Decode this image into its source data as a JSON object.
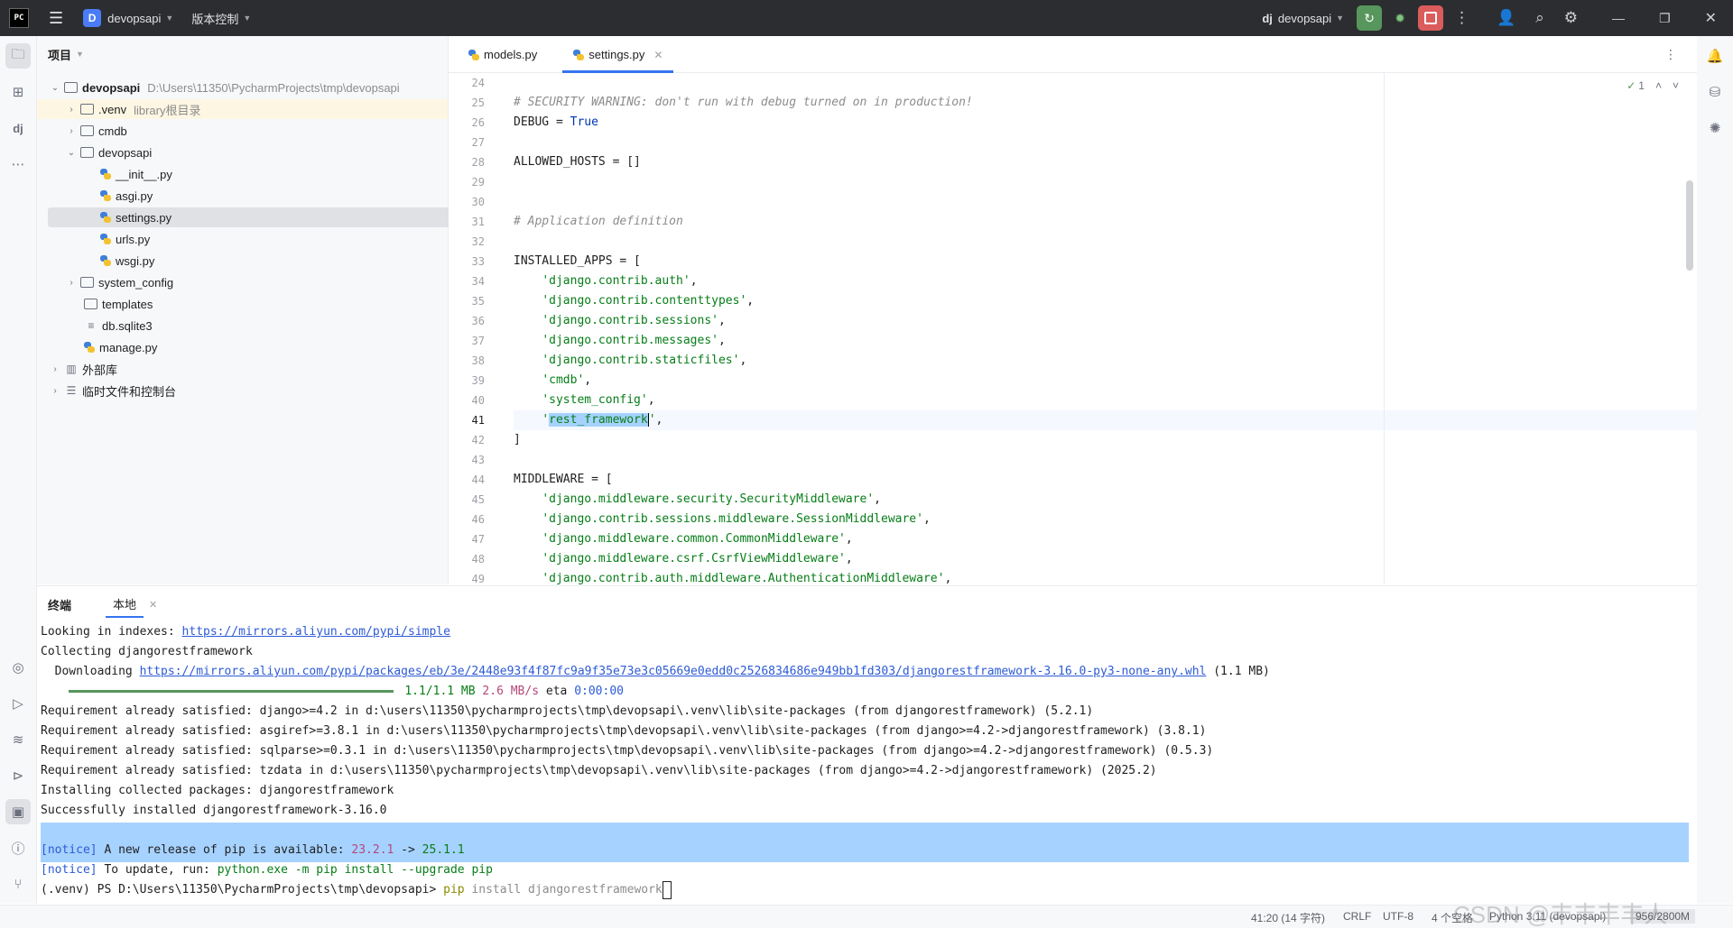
{
  "titlebar": {
    "app_logo": "PC",
    "project_badge": "D",
    "project_name": "devopsapi",
    "vcs_label": "版本控制",
    "run_config": "devopsapi",
    "run_config_icon": "dj"
  },
  "project_panel": {
    "title": "项目",
    "tree": [
      {
        "label": "devopsapi",
        "path": "D:\\Users\\11350\\PycharmProjects\\tmp\\devopsapi"
      },
      {
        "label": ".venv",
        "hint": "library根目录"
      },
      {
        "label": "cmdb"
      },
      {
        "label": "devopsapi"
      },
      {
        "label": "__init__.py"
      },
      {
        "label": "asgi.py"
      },
      {
        "label": "settings.py"
      },
      {
        "label": "urls.py"
      },
      {
        "label": "wsgi.py"
      },
      {
        "label": "system_config"
      },
      {
        "label": "templates"
      },
      {
        "label": "db.sqlite3"
      },
      {
        "label": "manage.py"
      },
      {
        "label": "外部库"
      },
      {
        "label": "临时文件和控制台"
      }
    ]
  },
  "editor": {
    "tabs": [
      {
        "label": "models.py"
      },
      {
        "label": "settings.py"
      }
    ],
    "inspection_count": "1",
    "line_numbers": [
      "24",
      "25",
      "26",
      "27",
      "28",
      "29",
      "30",
      "31",
      "32",
      "33",
      "34",
      "35",
      "36",
      "37",
      "38",
      "39",
      "40",
      "41",
      "42",
      "43",
      "44",
      "45",
      "46",
      "47",
      "48",
      "49"
    ],
    "code": {
      "l25": "# SECURITY WARNING: don't run with debug turned on in production!",
      "l26_a": "DEBUG = ",
      "l26_b": "True",
      "l28": "ALLOWED_HOSTS = []",
      "l31": "# Application definition",
      "l33": "INSTALLED_APPS = [",
      "l34": "'django.contrib.auth'",
      "l35": "'django.contrib.contenttypes'",
      "l36": "'django.contrib.sessions'",
      "l37": "'django.contrib.messages'",
      "l38": "'django.contrib.staticfiles'",
      "l39": "'cmdb'",
      "l40": "'system_config'",
      "l41_sel": "rest_framework",
      "l42": "]",
      "l44": "MIDDLEWARE = [",
      "l45": "'django.middleware.security.SecurityMiddleware'",
      "l46": "'django.contrib.sessions.middleware.SessionMiddleware'",
      "l47": "'django.middleware.common.CommonMiddleware'",
      "l48": "'django.middleware.csrf.CsrfViewMiddleware'",
      "l49": "'django.contrib.auth.middleware.AuthenticationMiddleware'"
    }
  },
  "terminal": {
    "tabs": [
      {
        "label": "终端"
      },
      {
        "label": "本地"
      }
    ],
    "lines": {
      "t1_a": "Looking in indexes: ",
      "t1_link": "https://mirrors.aliyun.com/pypi/simple",
      "t2": "Collecting djangorestframework",
      "t3_a": "  Downloading ",
      "t3_link": "https://mirrors.aliyun.com/pypi/packages/eb/3e/2448e93f4f87fc9a9f35e73e3c05669e0edd0c2526834686e949bb1fd303/djangorestframework-3.16.0-py3-none-any.whl",
      "t3_b": " (1.1 MB)",
      "t4_progress": "1.1/1.1 MB",
      "t4_speed": "2.6 MB/s",
      "t4_eta_label": "eta",
      "t4_eta": "0:00:00",
      "t5": "Requirement already satisfied: django>=4.2 in d:\\users\\11350\\pycharmprojects\\tmp\\devopsapi\\.venv\\lib\\site-packages (from djangorestframework) (5.2.1)",
      "t6": "Requirement already satisfied: asgiref>=3.8.1 in d:\\users\\11350\\pycharmprojects\\tmp\\devopsapi\\.venv\\lib\\site-packages (from django>=4.2->djangorestframework) (3.8.1)",
      "t7": "Requirement already satisfied: sqlparse>=0.3.1 in d:\\users\\11350\\pycharmprojects\\tmp\\devopsapi\\.venv\\lib\\site-packages (from django>=4.2->djangorestframework) (0.5.3)",
      "t8": "Requirement already satisfied: tzdata in d:\\users\\11350\\pycharmprojects\\tmp\\devopsapi\\.venv\\lib\\site-packages (from django>=4.2->djangorestframework) (2025.2)",
      "t9": "Installing collected packages: djangorestframework",
      "t10": "Successfully installed djangorestframework-3.16.0",
      "t12_a": "[notice]",
      "t12_b": " A new release of pip is available: ",
      "t12_c": "23.2.1",
      "t12_d": " -> ",
      "t12_e": "25.1.1",
      "t13_a": "[notice]",
      "t13_b": " To update, run: ",
      "t13_c": "python.exe -m pip install --upgrade pip",
      "t14_prompt": "(.venv) PS D:\\Users\\11350\\PycharmProjects\\tmp\\devopsapi> ",
      "t14_cmd_a": "pip",
      "t14_cmd_b": " install djangorestframework"
    }
  },
  "statusbar": {
    "position": "41:20 (14 字符)",
    "line_sep": "CRLF",
    "encoding": "UTF-8",
    "indent": "4 个空格",
    "interpreter": "Python 3.11 (devopsapi)",
    "memory": "956/2800M",
    "watermark": "CSDN @丰丰丰丰人"
  },
  "colors": {
    "titlebar": "#2b2d30",
    "accent": "#3574f0",
    "run_green": "#57965c",
    "stop_red": "#db5c5c"
  }
}
